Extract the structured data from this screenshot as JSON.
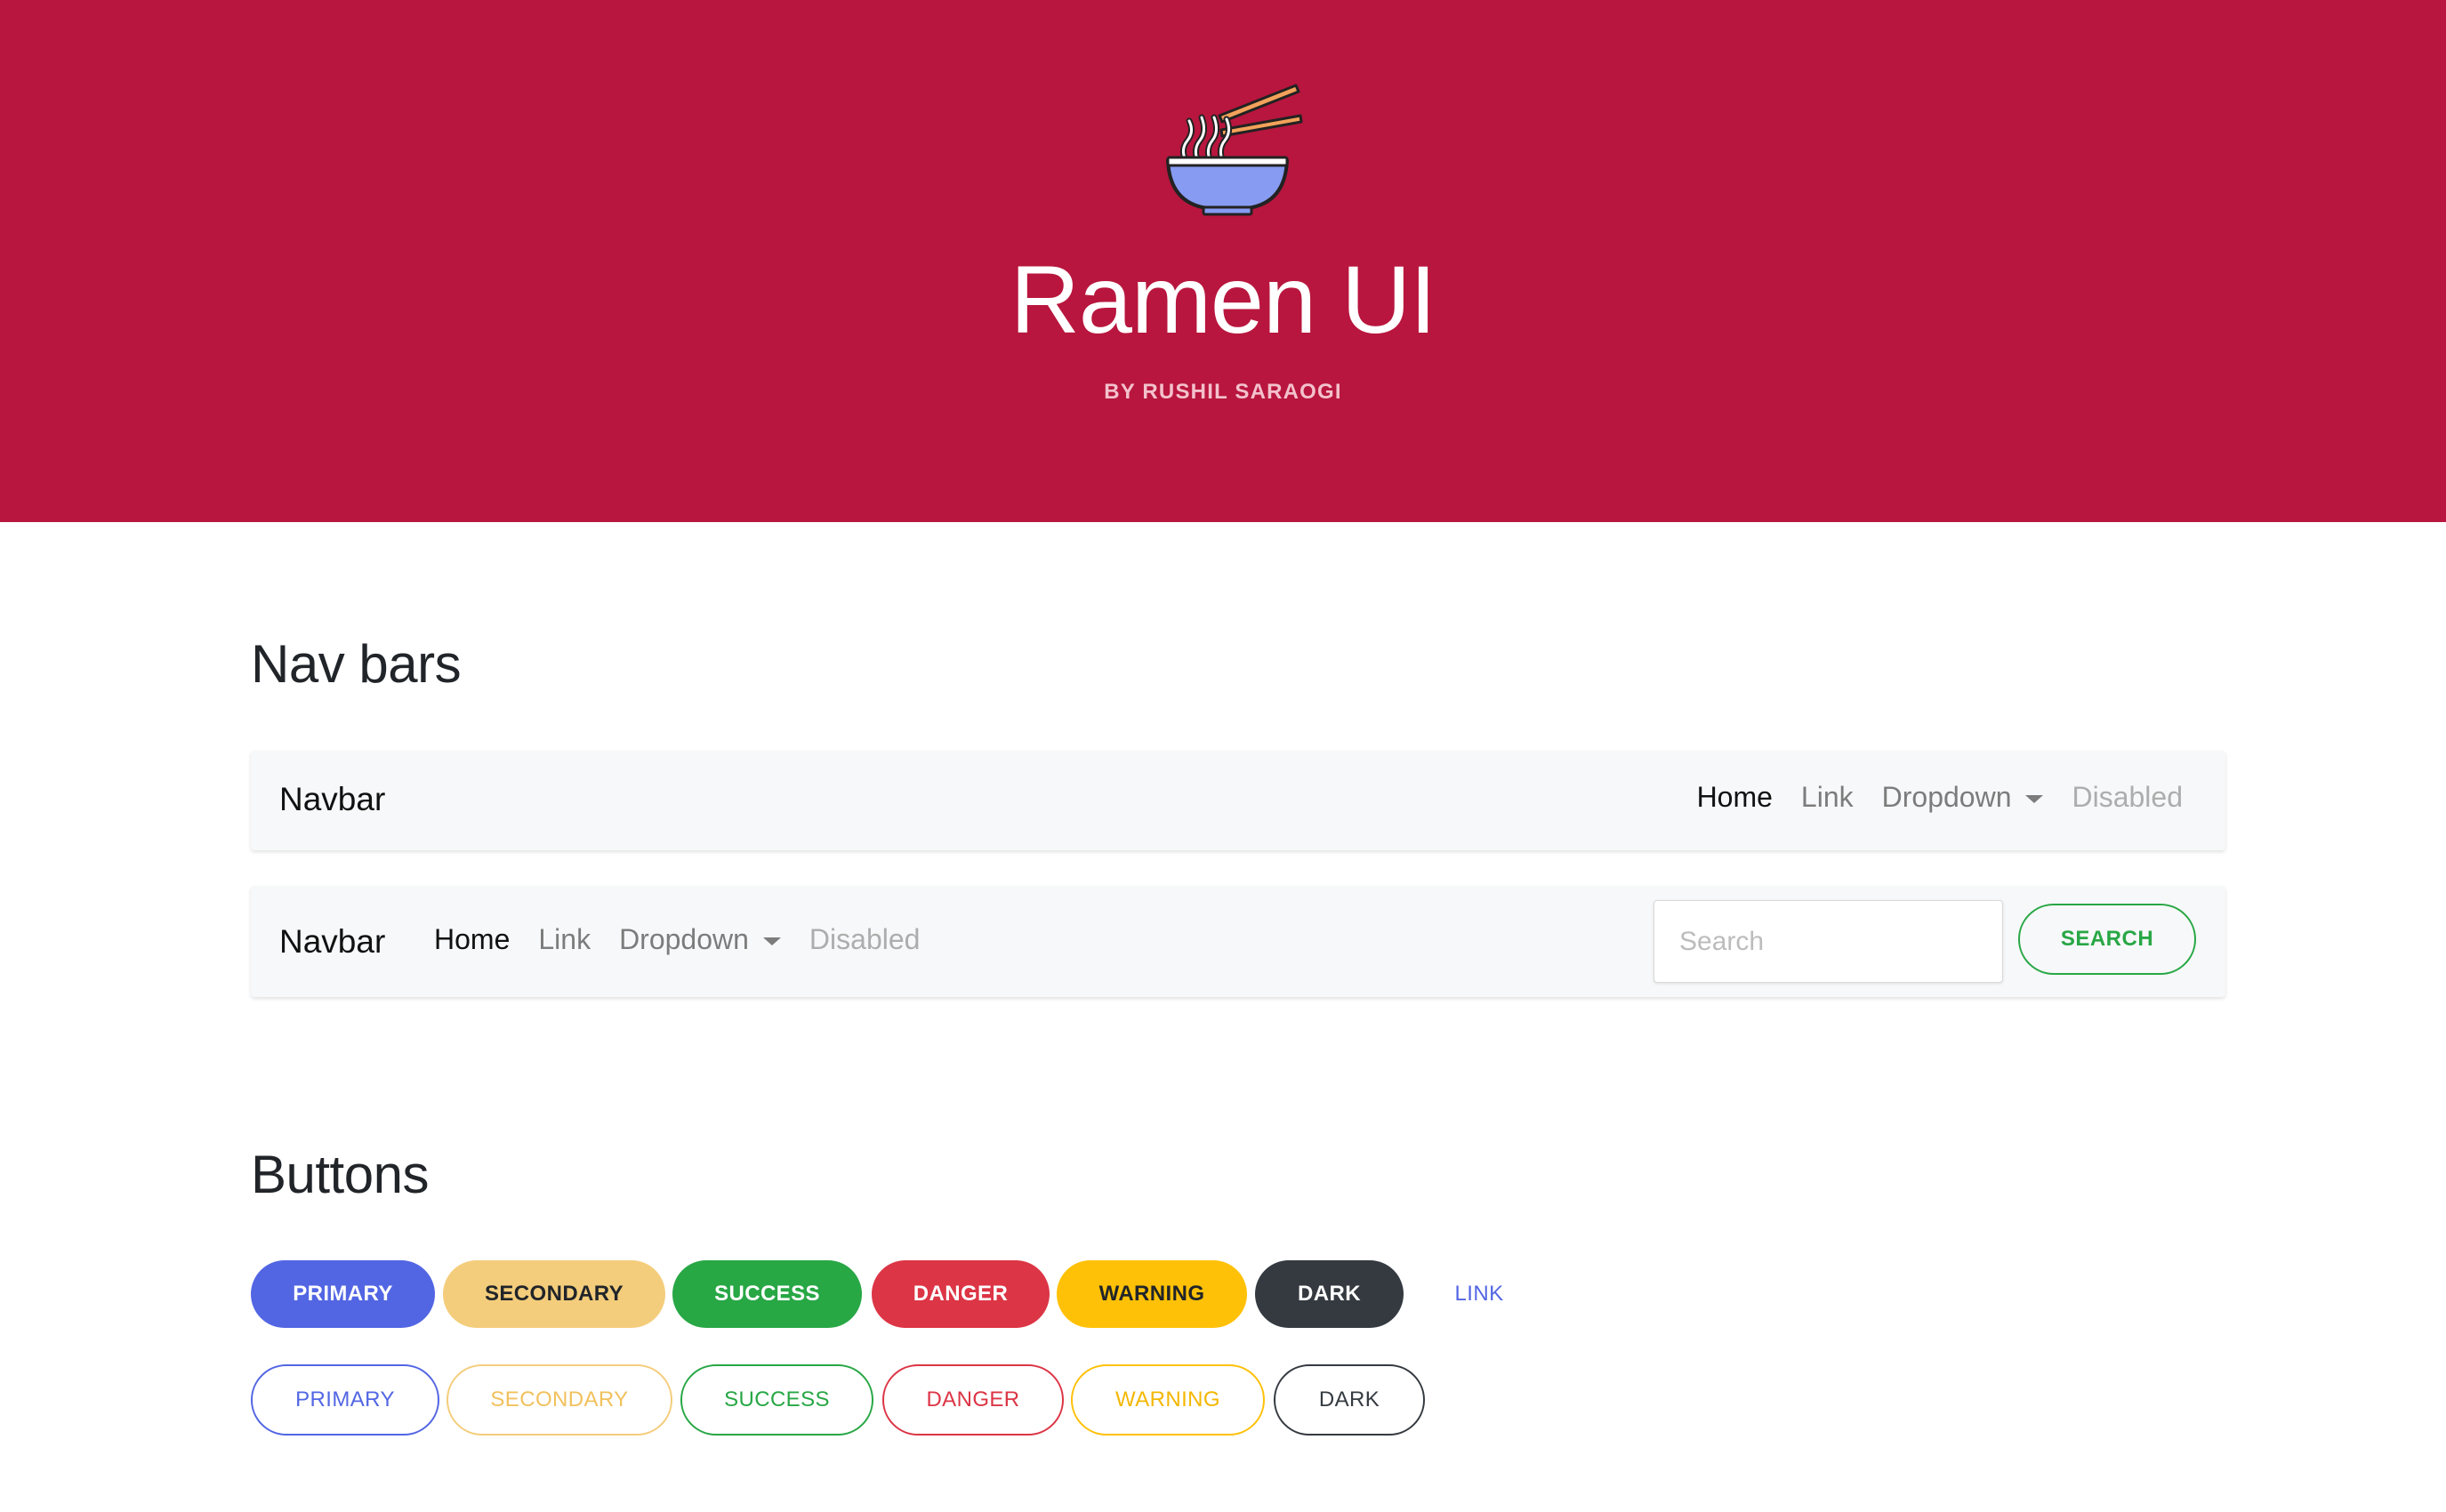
{
  "header": {
    "title": "Ramen UI",
    "subtitle": "BY RUSHIL SARAOGI",
    "logo_icon": "ramen-bowl-icon",
    "background_color": "#b8163e"
  },
  "sections": {
    "navbars_heading": "Nav bars",
    "buttons_heading": "Buttons"
  },
  "navbar1": {
    "brand": "Navbar",
    "links": [
      "Home",
      "Link",
      "Dropdown",
      "Disabled"
    ]
  },
  "navbar2": {
    "brand": "Navbar",
    "links": [
      "Home",
      "Link",
      "Dropdown",
      "Disabled"
    ],
    "search_placeholder": "Search",
    "search_button": "SEARCH"
  },
  "buttons": {
    "solid": [
      "PRIMARY",
      "SECONDARY",
      "SUCCESS",
      "DANGER",
      "WARNING",
      "DARK",
      "LINK"
    ],
    "outline": [
      "PRIMARY",
      "SECONDARY",
      "SUCCESS",
      "DANGER",
      "WARNING",
      "DARK"
    ]
  },
  "colors": {
    "primary": "#5266e3",
    "secondary": "#f4cd7c",
    "success": "#28a745",
    "danger": "#dc3545",
    "warning": "#ffc107",
    "dark": "#343a40"
  }
}
